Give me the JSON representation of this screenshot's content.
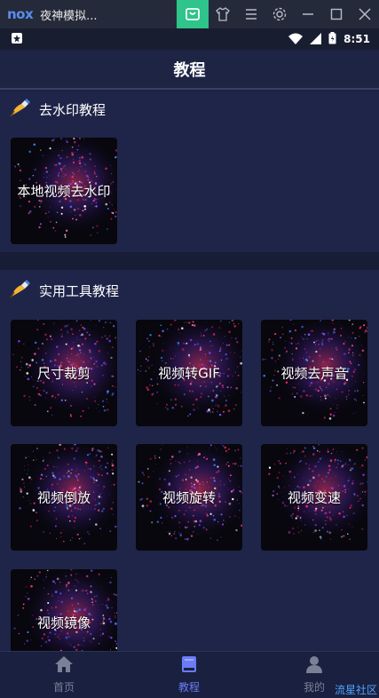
{
  "emulator": {
    "logo": "nox",
    "title": "夜神模拟...",
    "icons": [
      "store-icon",
      "shirt-icon",
      "menu-icon",
      "settings-icon",
      "minimize-icon",
      "maximize-icon",
      "close-icon"
    ]
  },
  "status_bar": {
    "time": "8:51",
    "icons": [
      "notification-icon",
      "wifi-icon",
      "signal-icon",
      "battery-icon"
    ]
  },
  "header": {
    "title": "教程"
  },
  "sections": [
    {
      "title": "去水印教程",
      "icon": "pen-icon",
      "cards": [
        {
          "label": "本地视频去水印"
        }
      ]
    },
    {
      "title": "实用工具教程",
      "icon": "pen-icon",
      "cards": [
        {
          "label": "尺寸裁剪"
        },
        {
          "label": "视频转GIF"
        },
        {
          "label": "视频去声音"
        },
        {
          "label": "视频倒放"
        },
        {
          "label": "视频旋转"
        },
        {
          "label": "视频变速"
        },
        {
          "label": "视频镜像"
        }
      ]
    }
  ],
  "bottom_nav": {
    "items": [
      {
        "label": "首页",
        "icon": "home-icon",
        "active": false
      },
      {
        "label": "教程",
        "icon": "book-icon",
        "active": true
      },
      {
        "label": "我的",
        "icon": "user-icon",
        "active": false
      }
    ],
    "active_color": "#6b7cf6",
    "inactive_color": "#7a8096"
  },
  "watermark": "流星社区",
  "colors": {
    "accent": "#2ec48a",
    "background": "#1c2240"
  }
}
